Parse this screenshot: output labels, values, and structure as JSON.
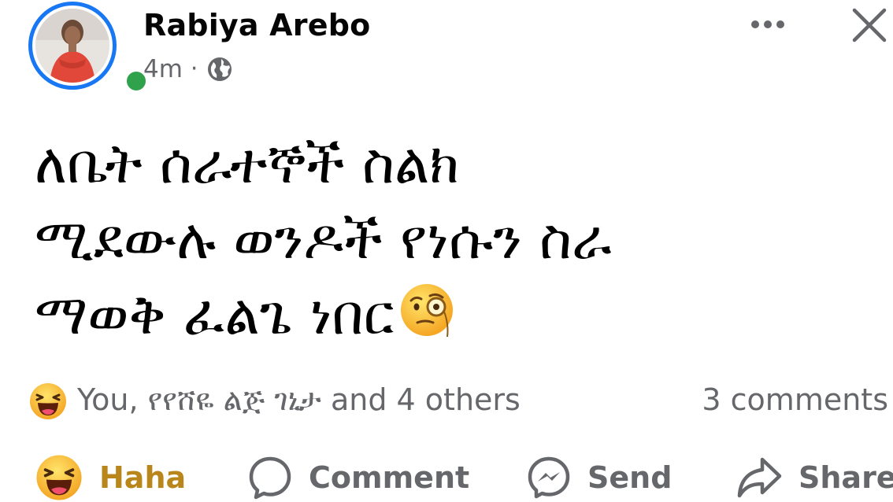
{
  "post": {
    "author": "Rabiya Arebo",
    "timestamp": "4m",
    "separator": "·",
    "audience_icon": "globe-icon",
    "menu_icon": "more-icon",
    "close_icon": "close-icon",
    "online": true,
    "text_lines": [
      "ለቤት ሰራተኞች ስልክ",
      "ሚደውሉ ወንዶች የነሱን ስራ",
      "ማወቅ ፈልጌ ነበር"
    ],
    "inline_emoji": "face-with-monocle-emoji"
  },
  "reactions": {
    "icon": "haha-emoji",
    "summary": "You, የየሸዬ ልጅ ገኒታ and 4 others",
    "comments": "3 comments"
  },
  "actions": {
    "haha": "Haha",
    "comment": "Comment",
    "send": "Send",
    "share": "Share"
  },
  "colors": {
    "accent": "#1877f2",
    "online": "#31a24c",
    "secondary_text": "#65676b",
    "haha_active": "#b8861b"
  }
}
